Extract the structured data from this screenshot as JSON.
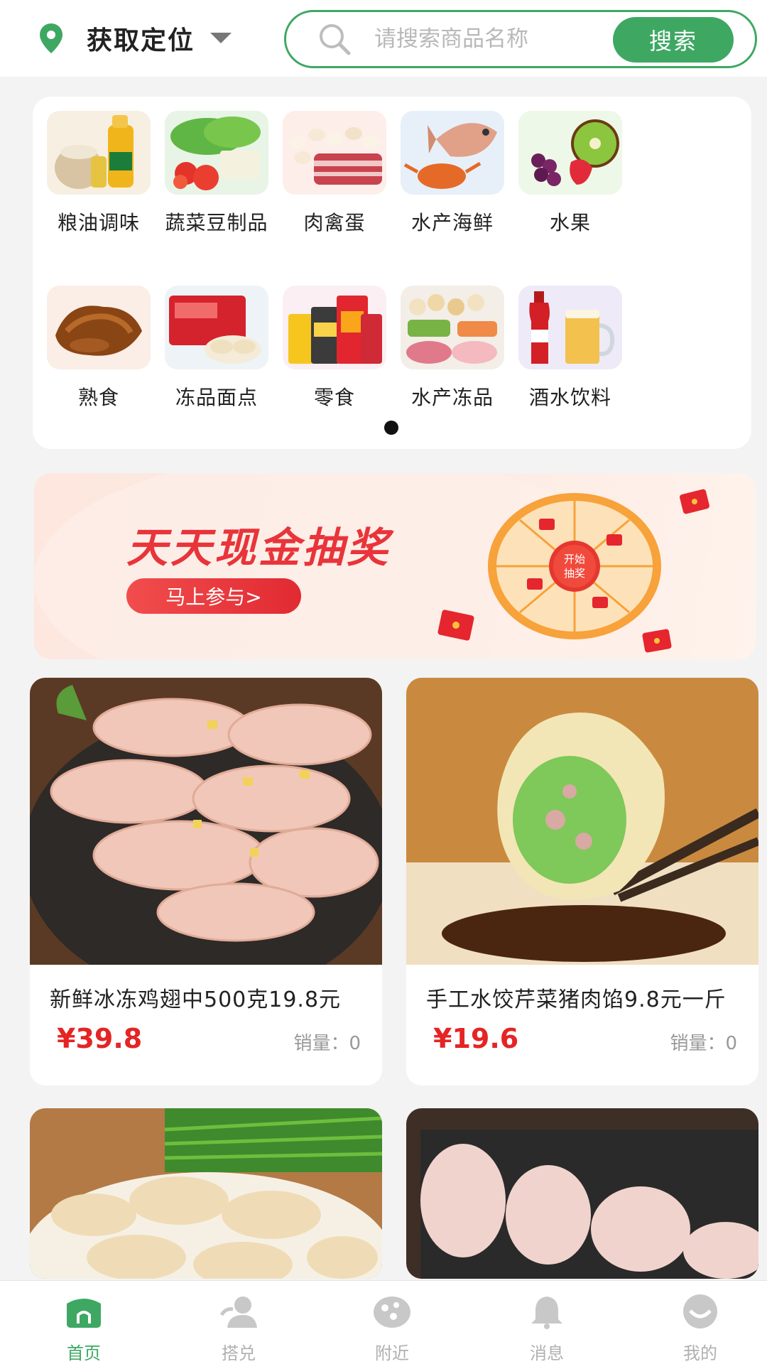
{
  "header": {
    "location_label": "获取定位",
    "search_placeholder": "请搜索商品名称",
    "search_button": "搜索"
  },
  "categories": [
    {
      "label": "粮油调味",
      "icon": "grain-oil-icon"
    },
    {
      "label": "蔬菜豆制品",
      "icon": "vegetable-icon"
    },
    {
      "label": "肉禽蛋",
      "icon": "meat-egg-icon"
    },
    {
      "label": "水产海鲜",
      "icon": "seafood-icon"
    },
    {
      "label": "水果",
      "icon": "fruit-icon"
    },
    {
      "label": "熟食",
      "icon": "cooked-food-icon"
    },
    {
      "label": "冻品面点",
      "icon": "frozen-dumpling-icon"
    },
    {
      "label": "零食",
      "icon": "snack-icon"
    },
    {
      "label": "水产冻品",
      "icon": "frozen-seafood-icon"
    },
    {
      "label": "酒水饮料",
      "icon": "drinks-icon"
    }
  ],
  "banner": {
    "title": "天天现金抽奖",
    "button": "马上参与>",
    "wheel_text": "开始抽奖"
  },
  "products": [
    {
      "name": "新鲜冰冻鸡翅中500克19.8元",
      "price": "¥39.8",
      "sales_label": "销量：",
      "sales": "0"
    },
    {
      "name": "手工水饺芹菜猪肉馅9.8元一斤",
      "price": "¥19.6",
      "sales_label": "销量：",
      "sales": "0"
    }
  ],
  "tabs": [
    {
      "label": "首页",
      "active": true
    },
    {
      "label": "搭兑",
      "active": false
    },
    {
      "label": "附近",
      "active": false
    },
    {
      "label": "消息",
      "active": false
    },
    {
      "label": "我的",
      "active": false
    }
  ],
  "colors": {
    "brand_green": "#3ea863",
    "price_red": "#e52424",
    "banner_red": "#e8343a"
  }
}
